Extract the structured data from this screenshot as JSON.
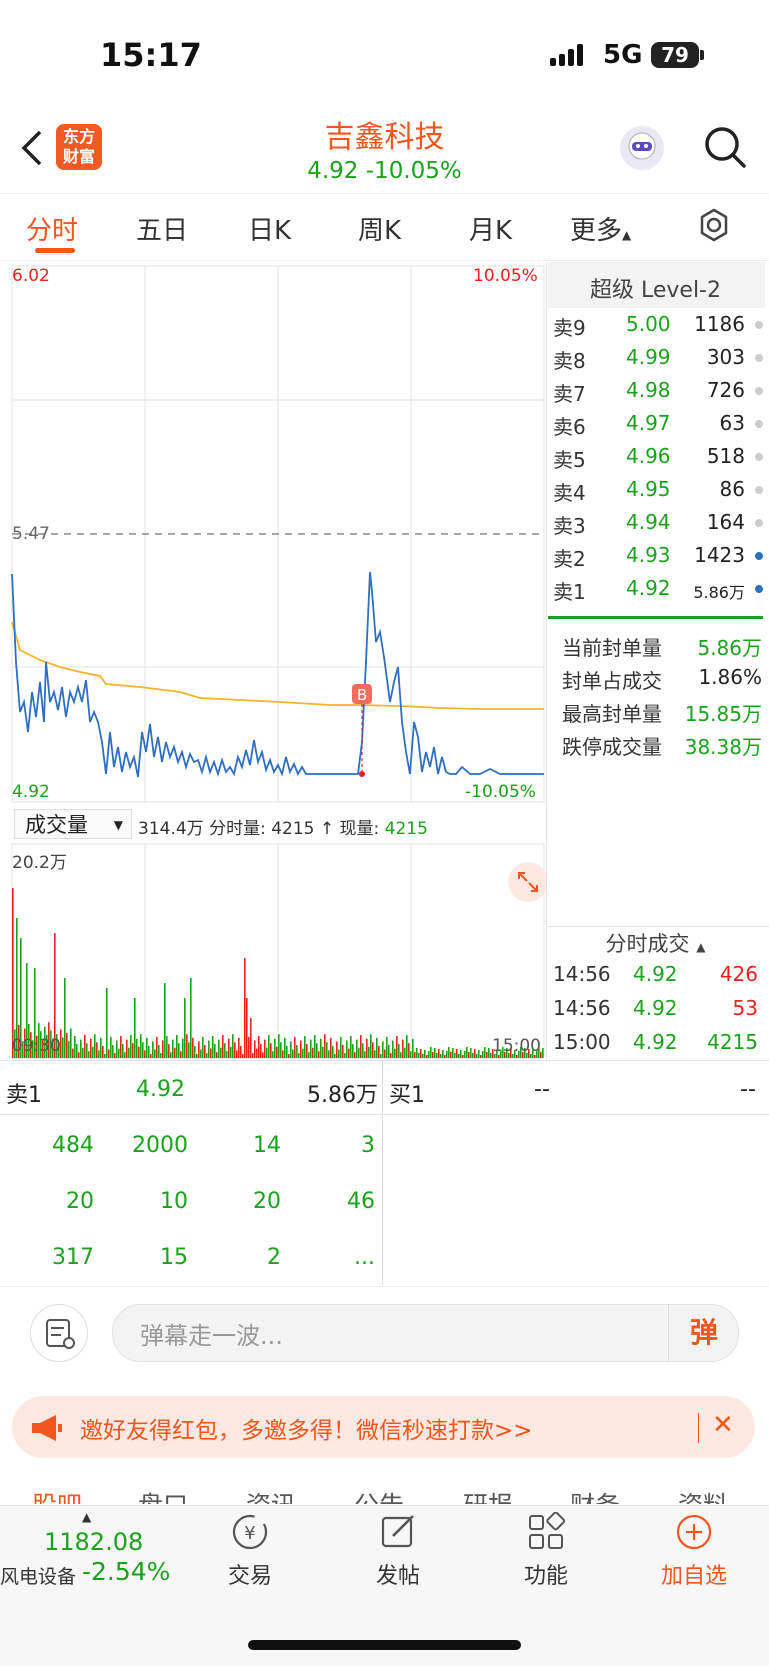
{
  "status_bar": {
    "time": "15:17",
    "network": "5G",
    "battery": "79"
  },
  "header": {
    "logo_line1": "东方",
    "logo_line2": "财富",
    "stock_name": "吉鑫科技",
    "price_line": "4.92  -10.05%"
  },
  "tabs": [
    "分时",
    "五日",
    "日K",
    "周K",
    "月K",
    "更多"
  ],
  "chart": {
    "price_high": "6.02",
    "pct_high": "10.05%",
    "prev_close": "5.47",
    "price_low": "4.92",
    "pct_low": "-10.05%",
    "volume_selector": "成交量",
    "volume_info": "314.4万 分时量: 4215 ↑ 现量: ",
    "volume_info_value": "4215",
    "volume_max": "20.2万",
    "time_start": "09:30",
    "time_end": "15:00",
    "buy_marker": "B"
  },
  "level2": {
    "title": "超级 Level-2",
    "asks": [
      {
        "name": "卖9",
        "price": "5.00",
        "vol": "1186"
      },
      {
        "name": "卖8",
        "price": "4.99",
        "vol": "303"
      },
      {
        "name": "卖7",
        "price": "4.98",
        "vol": "726"
      },
      {
        "name": "卖6",
        "price": "4.97",
        "vol": "63"
      },
      {
        "name": "卖5",
        "price": "4.96",
        "vol": "518"
      },
      {
        "name": "卖4",
        "price": "4.95",
        "vol": "86"
      },
      {
        "name": "卖3",
        "price": "4.94",
        "vol": "164"
      },
      {
        "name": "卖2",
        "price": "4.93",
        "vol": "1423"
      },
      {
        "name": "卖1",
        "price": "4.92",
        "vol": "5.86万"
      }
    ],
    "stats": [
      {
        "label": "当前封单量",
        "value": "5.86万"
      },
      {
        "label": "封单占成交",
        "value": "1.86%"
      },
      {
        "label": "最高封单量",
        "value": "15.85万"
      },
      {
        "label": "跌停成交量",
        "value": "38.38万"
      }
    ],
    "trades_title": "分时成交",
    "trades": [
      {
        "time": "14:56",
        "price": "4.92",
        "vol": "426"
      },
      {
        "time": "14:56",
        "price": "4.92",
        "vol": "53"
      },
      {
        "time": "15:00",
        "price": "4.92",
        "vol": "4215"
      }
    ]
  },
  "orderbook": {
    "sell_label": "卖1",
    "sell_price": "4.92",
    "sell_vol": "5.86万",
    "buy_label": "买1",
    "buy_price": "--",
    "buy_vol": "--",
    "queue": [
      [
        "484",
        "2000",
        "14",
        "3"
      ],
      [
        "20",
        "10",
        "20",
        "46"
      ],
      [
        "317",
        "15",
        "2",
        "..."
      ]
    ]
  },
  "danmu": {
    "placeholder": "弹幕走一波...",
    "button": "弹"
  },
  "promo": {
    "text": "邀好友得红包，多邀多得！微信秒速打款>>"
  },
  "subtabs": [
    "股吧",
    "盘口",
    "资讯",
    "公告",
    "研报",
    "财务",
    "资料"
  ],
  "bottom": {
    "index_value": "1182.08",
    "index_name": "风电设备",
    "index_change": "-2.54%",
    "buttons": [
      "交易",
      "发帖",
      "功能",
      "加自选"
    ]
  },
  "colors": {
    "accent": "#f2561d",
    "down": "#1aa31a",
    "up": "#e8231f",
    "price_line": "#2f6fc0",
    "avg_line": "#f5b428"
  }
}
